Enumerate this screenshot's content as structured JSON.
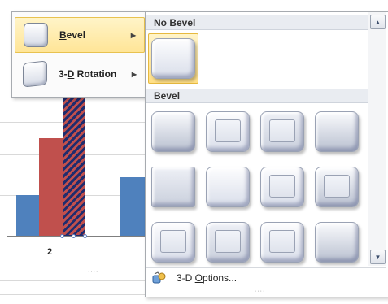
{
  "menu": {
    "items": [
      {
        "label": "Bevel",
        "hotkey_prefix": "",
        "hotkey": "B",
        "rest": "evel",
        "active": true,
        "icon": "bevel-shape-icon"
      },
      {
        "label": "3-D Rotation",
        "hotkey_prefix": "3-",
        "hotkey": "D",
        "rest": " Rotation",
        "active": false,
        "icon": "rotation-shape-icon"
      }
    ],
    "arrow": "▶"
  },
  "gallery": {
    "no_bevel_header": "No Bevel",
    "bevel_header": "Bevel",
    "scroll_up": "▲",
    "scroll_down": "▼",
    "footer": {
      "prefix": "3-D ",
      "hotkey": "O",
      "rest": "ptions..."
    }
  },
  "chart": {
    "category_label": "2",
    "colors": {
      "blue": "#4f81bd",
      "red": "#c0504d",
      "hatch_dark": "#1f2c6e"
    }
  },
  "grip": "····",
  "colors": {
    "accent_fill": "#ffe597",
    "accent_border": "#e6b93f"
  }
}
